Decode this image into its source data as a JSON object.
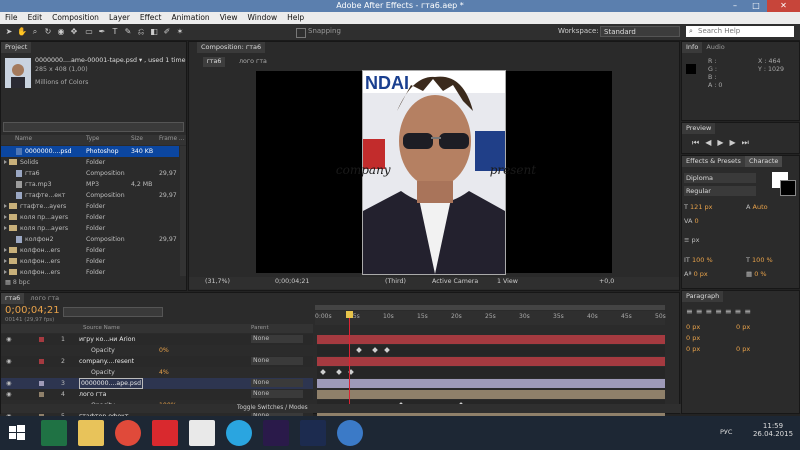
{
  "window": {
    "title": "Adobe After Effects - гта6.aep *",
    "minimize": "–",
    "maximize": "□",
    "close": "✕"
  },
  "menu": [
    "File",
    "Edit",
    "Composition",
    "Layer",
    "Effect",
    "Animation",
    "View",
    "Window",
    "Help"
  ],
  "toolbar": {
    "snapping": "Snapping",
    "workspace_label": "Workspace:",
    "workspace_value": "Standard",
    "search_placeholder": "Search Help"
  },
  "project": {
    "tab": "Project",
    "selected_name": "0000000....ame-00001-tape.psd ▾ , used 1 time",
    "selected_dims": "285 x 408 (1,00)",
    "selected_color": "Millions of Colors",
    "columns": {
      "name": "Name",
      "type": "Type",
      "size": "Size",
      "frame": "Frame ..."
    },
    "items": [
      {
        "name": "0000000....psd",
        "type": "Photoshop",
        "size": "340 KB",
        "frame": "",
        "icon": "file",
        "selected": true
      },
      {
        "name": "Solids",
        "type": "Folder",
        "size": "",
        "frame": "",
        "icon": "folder"
      },
      {
        "name": "гта6",
        "type": "Composition",
        "size": "",
        "frame": "29,97",
        "icon": "comp"
      },
      {
        "name": "гта.mp3",
        "type": "MP3",
        "size": "4,2 MB",
        "frame": "",
        "icon": "audio"
      },
      {
        "name": "гтафте...ект",
        "type": "Composition",
        "size": "",
        "frame": "29,97",
        "icon": "comp"
      },
      {
        "name": "гтафте...ayers",
        "type": "Folder",
        "size": "",
        "frame": "",
        "icon": "folder"
      },
      {
        "name": "коля пр...ayers",
        "type": "Folder",
        "size": "",
        "frame": "",
        "icon": "folder"
      },
      {
        "name": "коля пр...ayers",
        "type": "Folder",
        "size": "",
        "frame": "",
        "icon": "folder"
      },
      {
        "name": "колфон2",
        "type": "Composition",
        "size": "",
        "frame": "29,97",
        "icon": "comp"
      },
      {
        "name": "колфон...ers",
        "type": "Folder",
        "size": "",
        "frame": "",
        "icon": "folder"
      },
      {
        "name": "колфон...ers",
        "type": "Folder",
        "size": "",
        "frame": "",
        "icon": "folder"
      },
      {
        "name": "колфон...ers",
        "type": "Folder",
        "size": "",
        "frame": "",
        "icon": "folder"
      }
    ],
    "bpc": "8 bpc"
  },
  "composition": {
    "tab": "Composition: гта6",
    "sub_tabs": [
      "гта6",
      "лого гта"
    ],
    "overlay_text": "company                          present",
    "zoom": "(31,7%)",
    "timecode": "0;00;04;21",
    "resolution": "(Third)",
    "camera": "Active Camera",
    "view": "1 View",
    "exposure": "+0,0"
  },
  "info": {
    "tab": "Info",
    "tab2": "Audio",
    "r": "R :",
    "g": "G :",
    "b": "B :",
    "a": "A : 0",
    "x": "X : 464",
    "y": "Y : 1029"
  },
  "preview": {
    "tab": "Preview"
  },
  "character": {
    "tab_effects": "Effects & Presets",
    "tab_char": "Characte",
    "font": "Diploma",
    "style": "Regular",
    "size": "121 px",
    "leading": "Auto",
    "kerning": "0",
    "unit": "px",
    "vscale": "100 %",
    "hscale": "100 %",
    "baseline": "0 px",
    "tsume": "0 %"
  },
  "paragraph": {
    "tab": "Paragraph",
    "indent1": "0 px",
    "indent2": "0 px",
    "indent3": "0 px",
    "space1": "0 px",
    "space2": "0 px"
  },
  "timeline": {
    "tabs": [
      "гта6",
      "лого гта"
    ],
    "timecode": "0;00;04;21",
    "fps": "00141 (29,97 fps)",
    "col_source": "Source Name",
    "col_parent": "Parent",
    "ruler": [
      "0:00s",
      "05s",
      "10s",
      "15s",
      "20s",
      "25s",
      "30s",
      "35s",
      "40s",
      "45s",
      "50s"
    ],
    "toggle": "Toggle Switches / Modes",
    "layers": [
      {
        "num": "1",
        "name": "игру ко...ни Arion",
        "parent": "None",
        "prop": "Opacity",
        "prop_val": "0%",
        "bar_color": "#a53a40"
      },
      {
        "num": "2",
        "name": "company....resent",
        "parent": "None",
        "prop": "Opacity",
        "prop_val": "4%",
        "bar_color": "#a53a40"
      },
      {
        "num": "3",
        "name": "0000000....ape.psd",
        "parent": "None",
        "prop": "",
        "prop_val": "",
        "bar_color": "#9e9ab8"
      },
      {
        "num": "4",
        "name": "лого гта",
        "parent": "None",
        "prop": "Opacity",
        "prop_val": "100%",
        "bar_color": "#8f806a"
      },
      {
        "num": "5",
        "name": "гтафтер ефект",
        "parent": "None",
        "prop": "",
        "prop_val": "",
        "bar_color": "#8f806a"
      }
    ]
  },
  "taskbar": {
    "time": "11:59",
    "date": "26.04.2015",
    "lang": "РУС",
    "apps": [
      "windows",
      "excel",
      "explorer",
      "chrome",
      "yandex",
      "store",
      "skype",
      "aftereffects",
      "photoshop",
      "app"
    ]
  }
}
